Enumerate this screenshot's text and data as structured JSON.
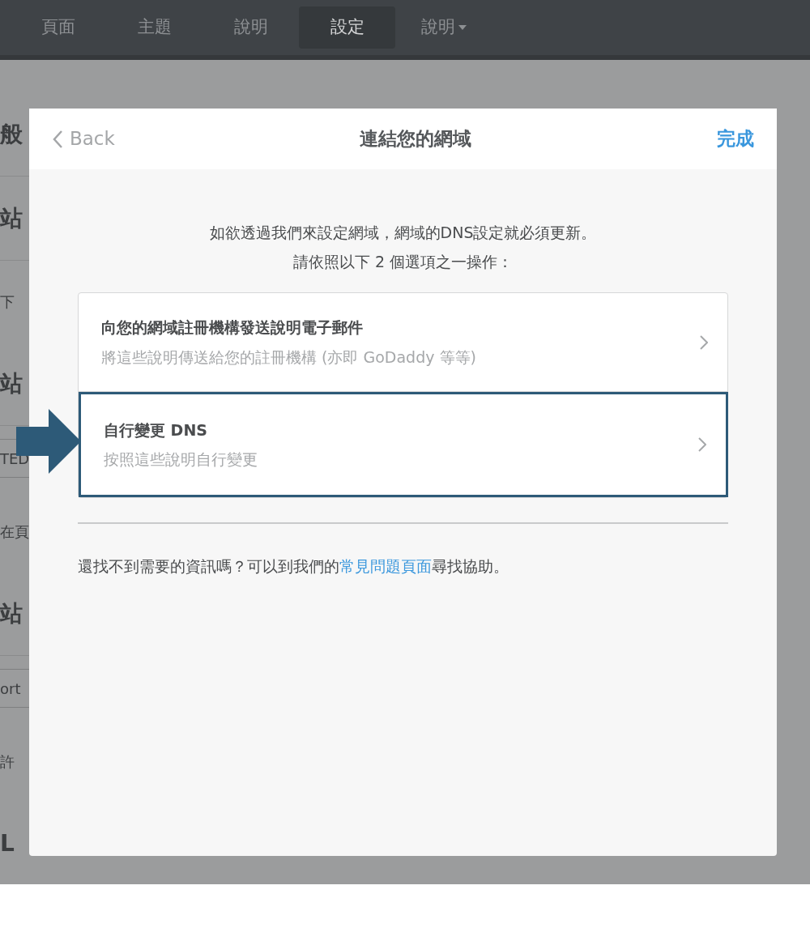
{
  "nav": {
    "tabs": [
      {
        "label": "頁面",
        "selected": false,
        "dropdown": false
      },
      {
        "label": "主題",
        "selected": false,
        "dropdown": false
      },
      {
        "label": "說明",
        "selected": false,
        "dropdown": false
      },
      {
        "label": "設定",
        "selected": true,
        "dropdown": false
      },
      {
        "label": "說明",
        "selected": false,
        "dropdown": true
      }
    ]
  },
  "background": {
    "rows": [
      {
        "kind": "heading",
        "text": "般"
      },
      {
        "kind": "heading",
        "text": "站"
      },
      {
        "kind": "text",
        "text": "下"
      },
      {
        "kind": "heading",
        "text": "站"
      },
      {
        "kind": "field",
        "text": "TED"
      },
      {
        "kind": "text",
        "text": "在頁"
      },
      {
        "kind": "heading",
        "text": "站"
      },
      {
        "kind": "field",
        "text": "ort"
      },
      {
        "kind": "text",
        "text": "許"
      },
      {
        "kind": "heading",
        "text": "L"
      }
    ]
  },
  "dialog": {
    "back": "Back",
    "title": "連結您的網域",
    "done": "完成",
    "intro": [
      "如欲透過我們來設定網域，網域的DNS設定就必須更新。",
      "請依照以下 2 個選項之一操作："
    ],
    "options": [
      {
        "title": "向您的網域註冊機構發送說明電子郵件",
        "subtitle": "將這些說明傳送給您的註冊機構 (亦即 GoDaddy 等等)",
        "highlighted": false
      },
      {
        "title": "自行變更 DNS",
        "subtitle": "按照這些說明自行變更",
        "highlighted": true
      }
    ],
    "help": {
      "before": "還找不到需要的資訊嗎？可以到我們的",
      "link": "常見問題頁面",
      "after": "尋找協助。"
    }
  }
}
